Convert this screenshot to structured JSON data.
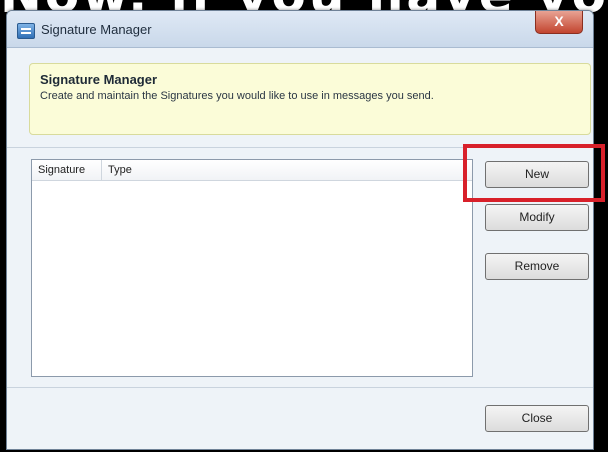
{
  "window": {
    "title": "Signature Manager",
    "close_glyph": "X"
  },
  "header": {
    "title": "Signature Manager",
    "description": "Create and maintain the Signatures you would like to use in messages you send."
  },
  "list": {
    "columns": [
      "Signature",
      "Type"
    ],
    "rows": []
  },
  "buttons": {
    "new": "New",
    "modify": "Modify",
    "remove": "Remove",
    "close": "Close"
  },
  "background_text": "Now, if you have yo",
  "colors": {
    "highlight": "#d8202a",
    "header_bg": "#fbfcd8"
  },
  "icons": [
    "app-icon",
    "close-icon"
  ]
}
